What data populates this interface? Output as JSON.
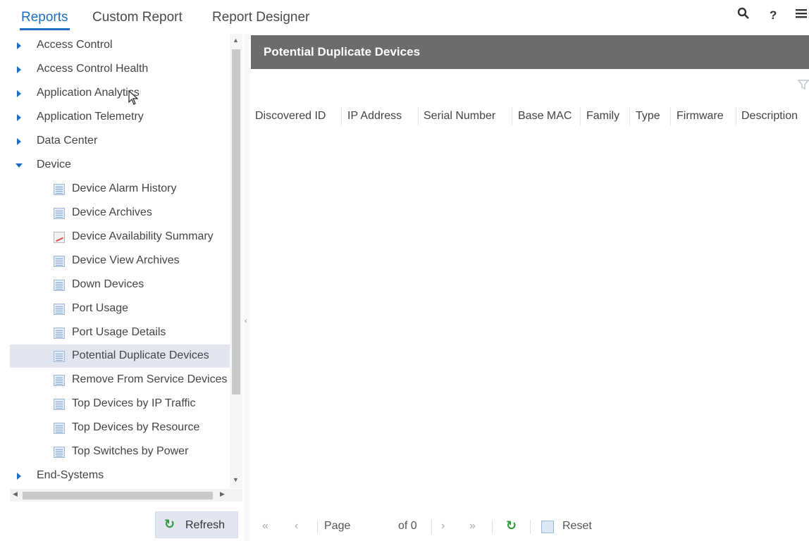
{
  "tabs": [
    {
      "label": "Reports",
      "active": true
    },
    {
      "label": "Custom Report",
      "active": false
    },
    {
      "label": "Report Designer",
      "active": false
    }
  ],
  "toolbar": {
    "search_icon": "search-icon",
    "help_label": "?",
    "menu_icon": "menu-icon"
  },
  "tree": {
    "items": [
      {
        "label": "Access Control",
        "type": "category",
        "expanded": false
      },
      {
        "label": "Access Control Health",
        "type": "category",
        "expanded": false
      },
      {
        "label": "Application Analytics",
        "type": "category",
        "expanded": false
      },
      {
        "label": "Application Telemetry",
        "type": "category",
        "expanded": false
      },
      {
        "label": "Data Center",
        "type": "category",
        "expanded": false
      },
      {
        "label": "Device",
        "type": "category",
        "expanded": true
      },
      {
        "label": "Device Alarm History",
        "type": "report"
      },
      {
        "label": "Device Archives",
        "type": "report"
      },
      {
        "label": "Device Availability Summary",
        "type": "chart-report"
      },
      {
        "label": "Device View Archives",
        "type": "report"
      },
      {
        "label": "Down Devices",
        "type": "report"
      },
      {
        "label": "Port Usage",
        "type": "report"
      },
      {
        "label": "Port Usage Details",
        "type": "report"
      },
      {
        "label": "Potential Duplicate Devices",
        "type": "report",
        "selected": true
      },
      {
        "label": "Remove From Service Devices",
        "type": "report"
      },
      {
        "label": "Top Devices by IP Traffic",
        "type": "report"
      },
      {
        "label": "Top Devices by Resource",
        "type": "report"
      },
      {
        "label": "Top Switches by Power",
        "type": "report"
      },
      {
        "label": "End-Systems",
        "type": "category",
        "expanded": false
      }
    ]
  },
  "refresh_button": {
    "label": "Refresh"
  },
  "panel": {
    "title": "Potential Duplicate Devices",
    "columns": [
      "Discovered ID",
      "IP Address",
      "Serial Number",
      "Base MAC",
      "Family",
      "Type",
      "Firmware",
      "Description"
    ]
  },
  "pager": {
    "page_label": "Page",
    "page_value": "",
    "of_label": "of 0",
    "reset_label": "Reset"
  },
  "colors": {
    "accent": "#1f6fc1",
    "header_bg": "#6c6c6c",
    "selected_bg": "#e1e6f1",
    "refresh_green": "#2e9a3a"
  }
}
